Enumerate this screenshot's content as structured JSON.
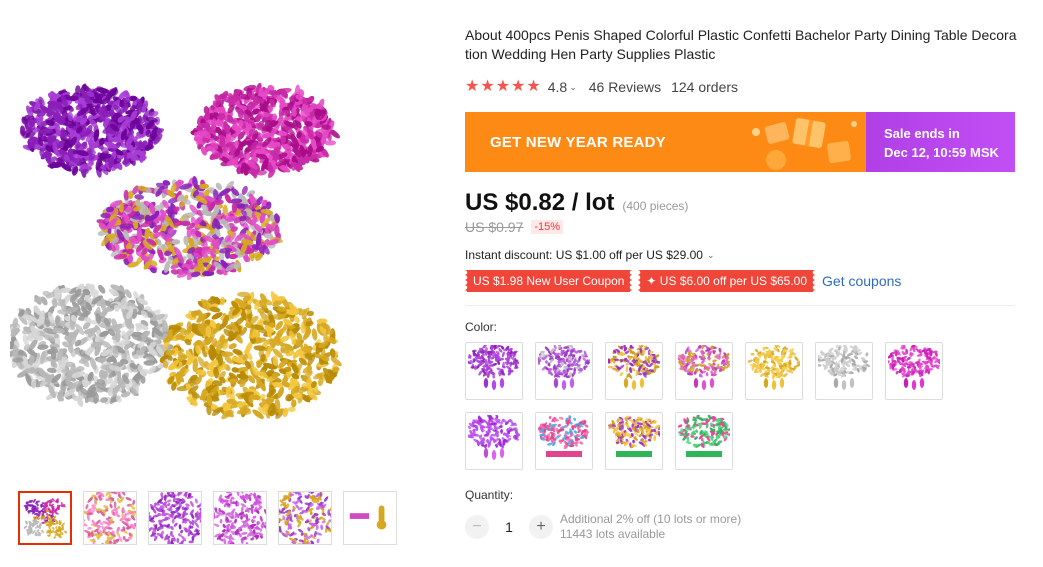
{
  "product": {
    "title": "About 400pcs Penis Shaped Colorful Plastic Confetti Bachelor Party Dining Table Decoration Wedding Hen Party Supplies Plastic",
    "rating": "4.8",
    "reviews": "46 Reviews",
    "orders": "124 orders",
    "stars_filled": 5
  },
  "banner": {
    "promo_text": "GET NEW YEAR READY",
    "sale_line1": "Sale ends in",
    "sale_line2": "Dec 12, 10:59 MSK",
    "promo_color": "#fd8a14",
    "sale_color": "#b94aee"
  },
  "pricing": {
    "price": "US $0.82 / lot",
    "pieces": "(400 pieces)",
    "old_price": "US $0.97",
    "discount": "-15%",
    "instant_discount": "Instant discount: US $1.00 off per US $29.00"
  },
  "coupons": {
    "new_user": "US $1.98 New User Coupon",
    "store": "✦ US $6.00 off per US $65.00",
    "get_link": "Get coupons"
  },
  "color": {
    "label": "Color:",
    "options": [
      {
        "name": "purple",
        "hues": [
          "#8a1fb8",
          "#a93ad4"
        ],
        "shape_hue": "#9b30c8"
      },
      {
        "name": "purple-silver",
        "hues": [
          "#9a34c4",
          "#c0c0c8"
        ],
        "shape_hue": "#a848d0"
      },
      {
        "name": "gold-purple",
        "hues": [
          "#c99a1e",
          "#9a2cc4"
        ],
        "shape_hue": "#d4a826"
      },
      {
        "name": "pink-gold",
        "hues": [
          "#c23ab4",
          "#d2a02a"
        ],
        "shape_hue": "#c23ab4"
      },
      {
        "name": "gold",
        "hues": [
          "#d6a820",
          "#e8c24a"
        ],
        "shape_hue": "#d6a820"
      },
      {
        "name": "silver",
        "hues": [
          "#a8a8a8",
          "#d0d0d0"
        ],
        "shape_hue": "#a8a8a8"
      },
      {
        "name": "magenta",
        "hues": [
          "#c81eb4",
          "#e04ccc"
        ],
        "shape_hue": "#c81eb4"
      },
      {
        "name": "violet",
        "hues": [
          "#9b28d2",
          "#b854e6"
        ],
        "shape_hue": "#c04cd6"
      },
      {
        "name": "mixed-pink",
        "hues": [
          "#e0448c",
          "#38b0e8"
        ],
        "shape_hue": "#e0448c"
      },
      {
        "name": "mixed-gold",
        "hues": [
          "#d4a020",
          "#9a2cc4"
        ],
        "shape_hue": "#2fb45a"
      },
      {
        "name": "mixed-green",
        "hues": [
          "#2fb45a",
          "#e8409c"
        ],
        "shape_hue": "#2fb45a"
      }
    ]
  },
  "quantity": {
    "label": "Quantity:",
    "value": "1",
    "minus": "−",
    "plus": "+",
    "note1": "Additional 2% off (10 lots or more)",
    "note2": "11443 lots available"
  },
  "gallery": {
    "main_piles": [
      "#8a1fb8",
      "#c82aa8",
      "#a030c8",
      "#b8b8b8",
      "#d6a820"
    ],
    "thumbs": [
      {
        "name": "thumb-1",
        "hues": [
          "#8a1fb8",
          "#d6a820"
        ]
      },
      {
        "name": "thumb-2",
        "hues": [
          "#d85aa0",
          "#e0c040"
        ]
      },
      {
        "name": "thumb-3",
        "hues": [
          "#8a1fb8",
          "#c050d8"
        ]
      },
      {
        "name": "thumb-4",
        "hues": [
          "#b028c0",
          "#d070d8"
        ]
      },
      {
        "name": "thumb-5",
        "hues": [
          "#a03ac8",
          "#d6a820"
        ]
      },
      {
        "name": "thumb-6",
        "hues": [
          "#d04cc0",
          "#d6a820"
        ]
      }
    ]
  }
}
